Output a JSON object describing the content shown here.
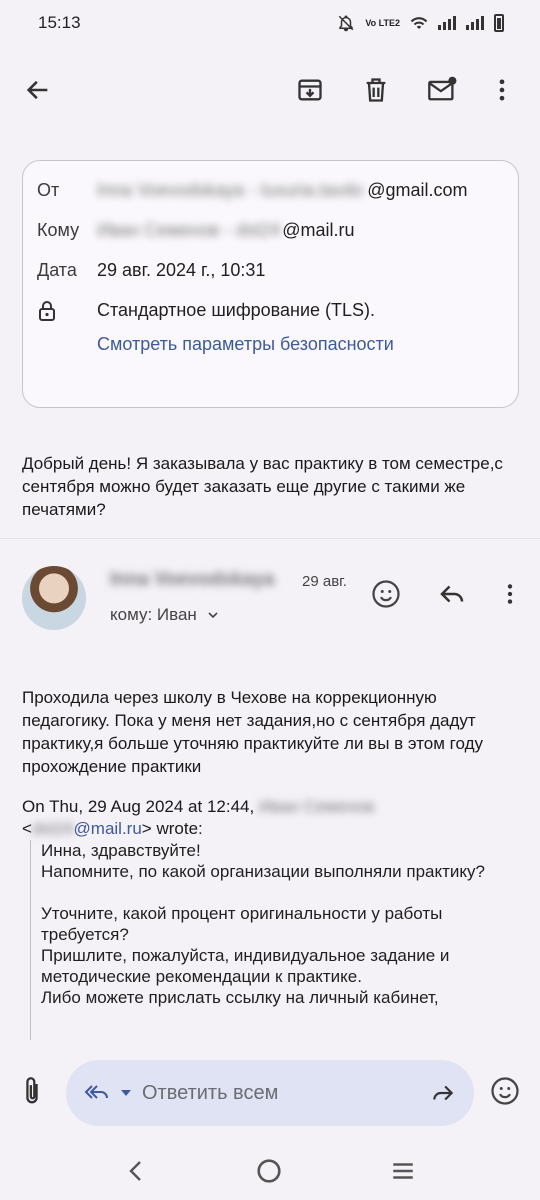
{
  "status_bar": {
    "time": "15:13",
    "volte_label": "Vo LTE2"
  },
  "header": {
    "from_label": "От",
    "from_name": "Inna Voevodskaya",
    "from_email_domain": "@gmail.com",
    "to_label": "Кому",
    "to_name": "Иван Семенов",
    "to_email_domain": "@mail.ru",
    "date_label": "Дата",
    "date_value": "29 авг. 2024 г., 10:31",
    "encryption": "Стандартное шифрование (TLS).",
    "security_link": "Смотреть параметры безопасности"
  },
  "first_message": "Добрый день! Я заказывала у вас практику в том семестре,с сентября можно будет заказать еще другие с такими же печатями?",
  "second_message": {
    "sender": "Inna Voevodskaya",
    "date": "29 авг.",
    "recipient": "кому: Иван",
    "body": "Проходила через школу в Чехове на коррекционную педагогику. Пока у меня нет задания,но с сентября дадут практику,я больше уточняю практикуйте ли вы в этом году прохождение практики",
    "quote_header_prefix": "On Thu, 29 Aug 2024 at 12:44,",
    "quote_header_name": "Иван Семенов",
    "quote_email_domain": "@mail.ru",
    "quote_wrote": "> wrote:",
    "quote_lt": "<",
    "quote_lines": [
      "Инна, здравствуйте!",
      "Напомните, по какой организации выполняли практику?",
      "Уточните, какой процент оригинальности у работы требуется?",
      "Пришлите, пожалуйста, индивидуальное задание и методические рекомендации к практике.",
      "Либо можете прислать ссылку на личный кабинет,"
    ]
  },
  "reply_bar": {
    "placeholder": "Ответить всем"
  },
  "colors": {
    "accent": "#3d5a9c",
    "pill": "#dfe3f4",
    "background": "#f4f1f7"
  }
}
